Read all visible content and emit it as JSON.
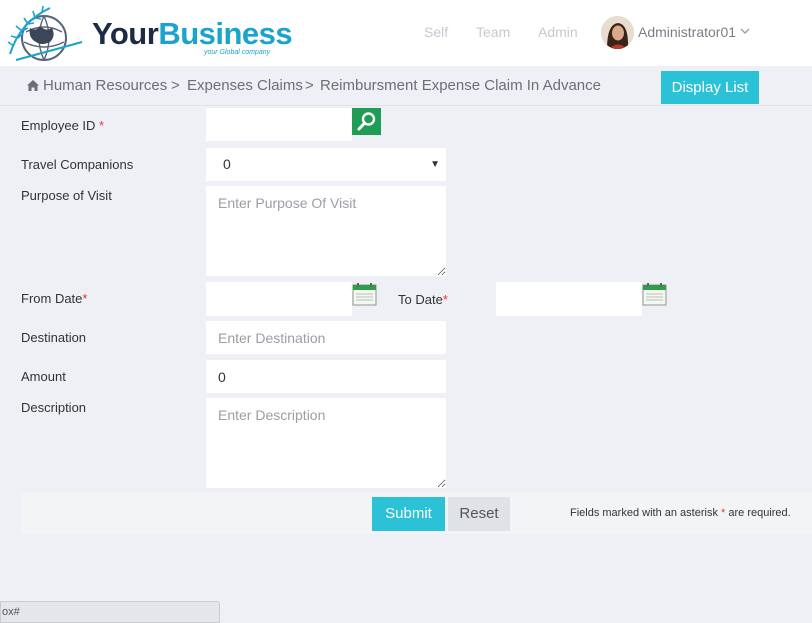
{
  "brand": {
    "name_part1": "Your",
    "name_part2": "Business",
    "tagline": "your Global company"
  },
  "nav": {
    "self": "Self",
    "team": "Team",
    "admin": "Admin",
    "user": "Administrator01"
  },
  "breadcrumb": {
    "items": [
      "Human Resources",
      "Expenses Claims",
      "Reimbursment Expense Claim In Advance"
    ],
    "separator": ">"
  },
  "actions": {
    "display_list": "Display List",
    "submit": "Submit",
    "reset": "Reset"
  },
  "form": {
    "employee_id": {
      "label": "Employee ID",
      "value": ""
    },
    "travel_companions": {
      "label": "Travel Companions",
      "value": "0"
    },
    "purpose": {
      "label": "Purpose of Visit",
      "placeholder": "Enter Purpose Of Visit"
    },
    "from_date": {
      "label": "From Date",
      "value": ""
    },
    "to_date": {
      "label": "To Date",
      "value": ""
    },
    "destination": {
      "label": "Destination",
      "placeholder": "Enter Destination"
    },
    "amount": {
      "label": "Amount",
      "value": "0"
    },
    "description": {
      "label": "Description",
      "placeholder": "Enter Description"
    },
    "required_mark": "*",
    "required_note_before": "Fields marked with an asterisk",
    "required_note_after": "are required."
  },
  "statusbar": {
    "text": "ox#"
  },
  "colors": {
    "accent": "#2bc1d6",
    "brand_dark": "#1d2b45",
    "brand_light": "#1aa3cc",
    "search_button": "#1f9d55",
    "required": "#e53935",
    "background": "#eef0f5"
  },
  "icons": {
    "home": "home-icon",
    "search": "search-icon",
    "calendar": "calendar-icon",
    "caret": "chevron-down-icon"
  }
}
